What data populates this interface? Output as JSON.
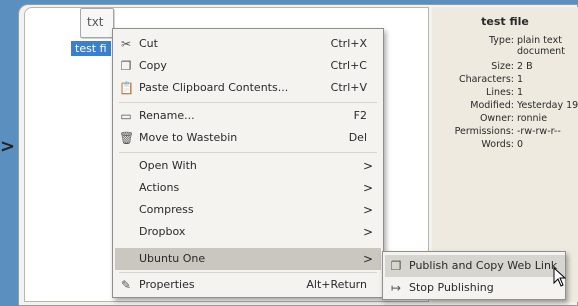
{
  "side_arrow": ">",
  "file": {
    "icon_text": "txt",
    "label": "test fi"
  },
  "info_panel": {
    "title": "test file",
    "rows": [
      {
        "key": "Type:",
        "value": "plain text"
      },
      {
        "key": "",
        "value": "document"
      },
      {
        "key": "Size:",
        "value": "2 B"
      },
      {
        "key": "Characters:",
        "value": "1"
      },
      {
        "key": "Lines:",
        "value": "1"
      },
      {
        "key": "Modified:",
        "value": "Yesterday 19:"
      },
      {
        "key": "Owner:",
        "value": "ronnie"
      },
      {
        "key": "Permissions:",
        "value": "-rw-rw-r--"
      },
      {
        "key": "Words:",
        "value": "0"
      }
    ]
  },
  "menu": {
    "items": [
      {
        "label": "Cut",
        "shortcut": "Ctrl+X",
        "icon": "scissors-icon"
      },
      {
        "label": "Copy",
        "shortcut": "Ctrl+C",
        "icon": "copy-icon"
      },
      {
        "label": "Paste Clipboard Contents...",
        "shortcut": "Ctrl+V",
        "icon": "paste-icon"
      },
      {
        "label": "Rename...",
        "shortcut": "F2",
        "icon": "rename-icon"
      },
      {
        "label": "Move to Wastebin",
        "shortcut": "Del",
        "icon": "wastebin-icon"
      },
      {
        "label": "Open With",
        "arrow": ">"
      },
      {
        "label": "Actions",
        "arrow": ">"
      },
      {
        "label": "Compress",
        "arrow": ">"
      },
      {
        "label": "Dropbox",
        "arrow": ">"
      },
      {
        "label": "Ubuntu One",
        "arrow": ">"
      },
      {
        "label": "Properties",
        "shortcut": "Alt+Return",
        "icon": "properties-icon"
      }
    ]
  },
  "submenu": {
    "items": [
      {
        "label": "Publish and Copy Web Link",
        "icon": "publish-icon"
      },
      {
        "label": "Stop Publishing",
        "icon": "stop-publishing-icon"
      }
    ]
  }
}
